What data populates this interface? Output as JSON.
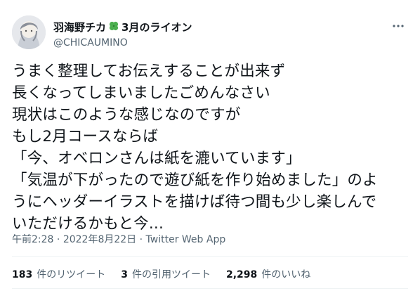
{
  "author": {
    "name_part1": "羽海野チカ",
    "name_part2": "3月のライオン",
    "handle": "@CHICAUMINO"
  },
  "tweet": {
    "text": "うまく整理してお伝えすることが出来ず\n長くなってしまいましたごめんなさい\n現状はこのような感じなのですが\nもし2月コースならば\n「今、オベロンさんは紙を漉いています」\n「気温が下がったので遊び紙を作り始めました」のよ\nうにヘッダーイラストを描けば待つ間も少し楽しんで\nいただけるかもと今...",
    "time": "午前2:28",
    "date": "2022年8月22日",
    "app": "Twitter Web App"
  },
  "stats": {
    "retweets_count": "183",
    "retweets_label": "件のリツイート",
    "quotes_count": "3",
    "quotes_label": "件の引用ツイート",
    "likes_count": "2,298",
    "likes_label": "件のいいね"
  },
  "colors": {
    "text": "#0f1419",
    "secondary": "#536471",
    "clover": "#4caf50",
    "divider": "#eff3f4"
  },
  "icons": [
    "avatar",
    "clover-icon",
    "more-icon"
  ]
}
